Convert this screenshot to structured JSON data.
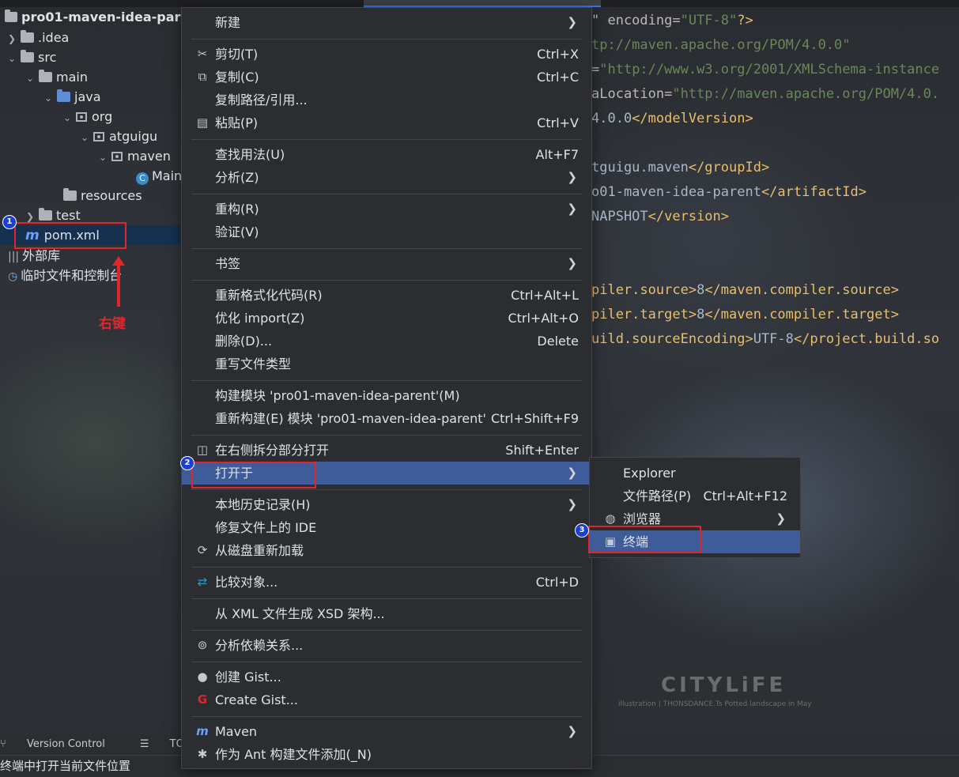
{
  "project_tree": {
    "root": "pro01-maven-idea-parent",
    "items": [
      {
        "label": ".idea"
      },
      {
        "label": "src"
      },
      {
        "label": "main"
      },
      {
        "label": "java"
      },
      {
        "label": "org"
      },
      {
        "label": "atguigu"
      },
      {
        "label": "maven"
      },
      {
        "label": "Main"
      },
      {
        "label": "resources"
      },
      {
        "label": "test"
      },
      {
        "label": "pom.xml"
      },
      {
        "label": "外部库"
      },
      {
        "label": "临时文件和控制台"
      }
    ],
    "annotation_label": "右键"
  },
  "badges": {
    "b1": "1",
    "b2": "2",
    "b3": "3"
  },
  "editor": {
    "lines": [
      {
        "a": "\" encoding=",
        "b": "\"UTF-8\"",
        "c": "?>"
      },
      {
        "a": "tp://maven.apache.org/POM/4.0.0\""
      },
      {
        "a": "=",
        "b": "\"http://www.w3.org/2001/XMLSchema-instance"
      },
      {
        "a": "aLocation=",
        "b": "\"http://maven.apache.org/POM/4.0."
      },
      {
        "a": "4.0.0",
        "b": "</modelVersion>"
      },
      {
        "a": "tguigu.maven",
        "b": "</groupId>"
      },
      {
        "a": "o01-maven-idea-parent",
        "b": "</artifactId>"
      },
      {
        "a": "NAPSHOT",
        "b": "</version>"
      },
      {
        "a": "piler.source>",
        "b": "8",
        "c": "</maven.compiler.source>"
      },
      {
        "a": "piler.target>",
        "b": "8",
        "c": "</maven.compiler.target>"
      },
      {
        "a": "uild.sourceEncoding>",
        "b": "UTF-8",
        "c": "</project.build.so"
      }
    ],
    "wallpaper_title": "CITYLiFE",
    "wallpaper_sub": "illustration | THONSDANCE.Ts     Potted landscape in May"
  },
  "menu": {
    "new": "新建",
    "cut": "剪切(T)",
    "cut_sc": "Ctrl+X",
    "copy": "复制(C)",
    "copy_sc": "Ctrl+C",
    "copy_path": "复制路径/引用...",
    "paste": "粘贴(P)",
    "paste_sc": "Ctrl+V",
    "find_usages": "查找用法(U)",
    "find_usages_sc": "Alt+F7",
    "analyze": "分析(Z)",
    "refactor": "重构(R)",
    "validate": "验证(V)",
    "bookmarks": "书签",
    "reformat": "重新格式化代码(R)",
    "reformat_sc": "Ctrl+Alt+L",
    "optimize_imports": "优化 import(Z)",
    "optimize_imports_sc": "Ctrl+Alt+O",
    "delete": "删除(D)...",
    "delete_sc": "Delete",
    "override_type": "重写文件类型",
    "build_module": "构建模块 'pro01-maven-idea-parent'(M)",
    "rebuild_module": "重新构建(E) 模块 'pro01-maven-idea-parent'",
    "rebuild_module_sc": "Ctrl+Shift+F9",
    "open_right_split": "在右侧拆分部分打开",
    "open_right_split_sc": "Shift+Enter",
    "open_in": "打开于",
    "local_history": "本地历史记录(H)",
    "repair_ide": "修复文件上的 IDE",
    "reload_from_disk": "从磁盘重新加载",
    "compare_with": "比较对象...",
    "compare_with_sc": "Ctrl+D",
    "generate_xsd": "从 XML 文件生成 XSD 架构...",
    "analyze_deps": "分析依赖关系...",
    "create_gist": "创建 Gist...",
    "create_gist2": "Create Gist...",
    "maven": "Maven",
    "add_ant": "作为 Ant 构建文件添加(_N)"
  },
  "submenu": {
    "explorer": "Explorer",
    "file_path": "文件路径(P)",
    "file_path_sc": "Ctrl+Alt+F12",
    "browser": "浏览器",
    "terminal": "终端"
  },
  "toolstrip": {
    "vc": "Version Control",
    "todo": "TODO"
  },
  "status": {
    "text": "终端中打开当前文件位置"
  }
}
